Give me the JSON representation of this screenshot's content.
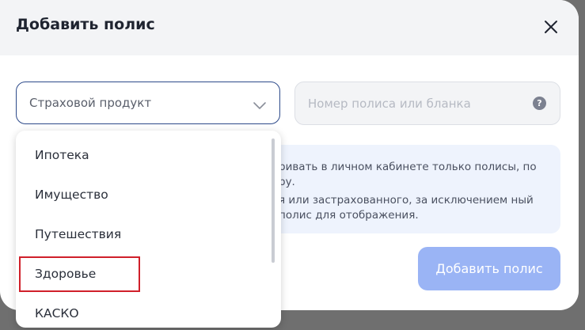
{
  "modal": {
    "title": "Добавить полис"
  },
  "form": {
    "product_placeholder": "Страховой продукт",
    "policy_placeholder": "Номер полиса или бланка",
    "help_glyph": "?",
    "submit_label": "Добавить полис"
  },
  "info": {
    "text_1": "ривать в личном кабинете только полисы, по ру.",
    "text_2": "я или застрахованного, за исключением ный полис для отображения."
  },
  "dropdown": {
    "items": [
      {
        "label": "Ипотека"
      },
      {
        "label": "Имущество"
      },
      {
        "label": "Путешествия"
      },
      {
        "label": "Здоровье"
      },
      {
        "label": "КАСКО"
      }
    ]
  },
  "icons": {
    "close": "close-icon",
    "chevron": "chevron-down-icon",
    "help": "help-icon"
  },
  "colors": {
    "accent_border": "#2d4a8a",
    "button_bg": "#9ab4f5",
    "info_bg": "#eef3fd",
    "highlight": "#d0202a"
  }
}
